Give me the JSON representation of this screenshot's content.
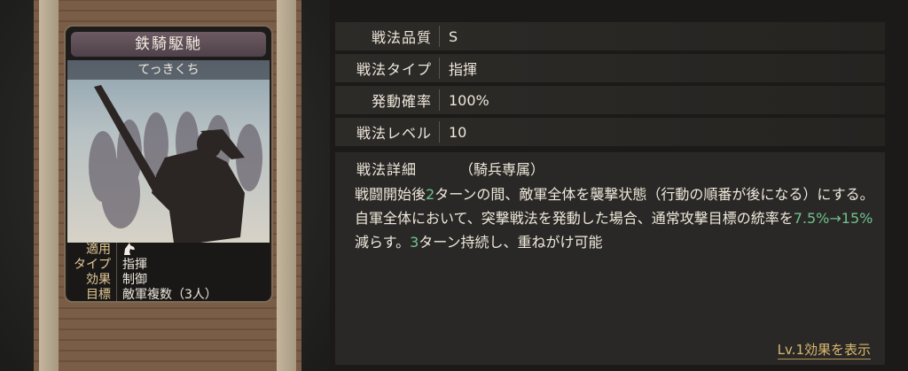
{
  "card": {
    "name": "鉄騎駆馳",
    "reading": "てっきくち",
    "info": [
      {
        "key": "適用",
        "value": ""
      },
      {
        "key": "タイプ",
        "value": "指揮"
      },
      {
        "key": "効果",
        "value": "制御"
      },
      {
        "key": "目標",
        "value": "敵軍複数（3人）"
      }
    ]
  },
  "stats": [
    {
      "label": "戦法品質",
      "value": "S"
    },
    {
      "label": "戦法タイプ",
      "value": "指揮"
    },
    {
      "label": "発動確率",
      "value": "100%"
    },
    {
      "label": "戦法レベル",
      "value": "10"
    }
  ],
  "detail": {
    "title": "戦法詳細",
    "tag": "（騎兵専属）",
    "parts": [
      {
        "text": "戦闘開始後",
        "hl": false
      },
      {
        "text": "2",
        "hl": true
      },
      {
        "text": "ターンの間、敵軍全体を襲撃状態（行動の順番が後になる）にする。自軍全体において、突撃戦法を発動した場合、通常攻撃目標の統率を",
        "hl": false
      },
      {
        "text": "7.5%→15%",
        "hl": true
      },
      {
        "text": "減らす。",
        "hl": false
      },
      {
        "text": "3",
        "hl": true
      },
      {
        "text": "ターン持続し、重ねがけ可能",
        "hl": false
      }
    ],
    "level_link": "Lv.1効果を表示"
  },
  "colors": {
    "highlight": "#6fc28e",
    "link": "#d9b870",
    "label_gold": "#e2c896"
  },
  "icons": {
    "applies": "horse-icon"
  }
}
